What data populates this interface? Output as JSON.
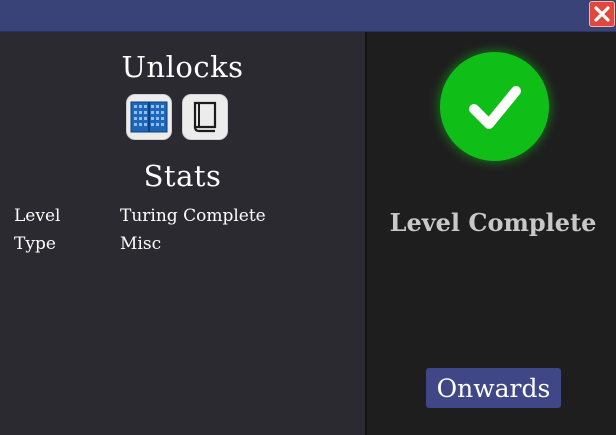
{
  "window": {
    "close_icon": "close-x-icon"
  },
  "left": {
    "unlocks_title": "Unlocks",
    "unlock_items": [
      {
        "icon": "component-chip-icon"
      },
      {
        "icon": "notebook-icon"
      }
    ],
    "stats_title": "Stats",
    "stats": [
      {
        "key": "Level",
        "value": "Turing Complete"
      },
      {
        "key": "Type",
        "value": "Misc"
      }
    ]
  },
  "right": {
    "status_icon": "checkmark-icon",
    "status_text": "Level Complete",
    "onwards_label": "Onwards"
  },
  "colors": {
    "titlebar": "#3a4378",
    "close": "#e0483d",
    "success": "#0fbe17",
    "button": "#3f4786"
  }
}
